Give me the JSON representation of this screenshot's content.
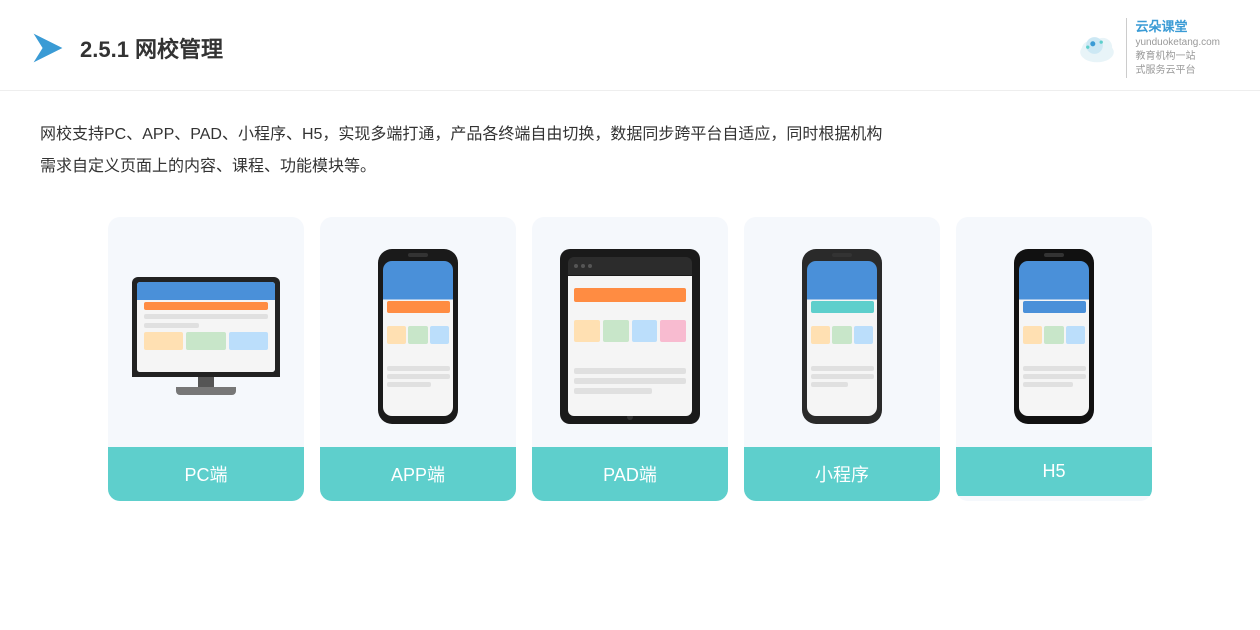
{
  "header": {
    "section_number": "2.5.1",
    "title_plain": "2.5.1 ",
    "title_bold": "网校管理",
    "brand_name": "云朵课堂",
    "brand_site": "yunduoketang.com",
    "brand_slogan_line1": "教育机构一站",
    "brand_slogan_line2": "式服务云平台"
  },
  "description": {
    "text_line1": "网校支持PC、APP、PAD、小程序、H5，实现多端打通，产品各终端自由切换，数据同步跨平台自适应，同时根据机构",
    "text_line2": "需求自定义页面上的内容、课程、功能模块等。"
  },
  "cards": [
    {
      "id": "pc",
      "label": "PC端"
    },
    {
      "id": "app",
      "label": "APP端"
    },
    {
      "id": "pad",
      "label": "PAD端"
    },
    {
      "id": "mini",
      "label": "小程序"
    },
    {
      "id": "h5",
      "label": "H5"
    }
  ],
  "colors": {
    "card_bg": "#f0f5fb",
    "card_label_bg": "#5ecfcc",
    "title_color": "#333333",
    "text_color": "#333333",
    "accent_blue": "#4a90d9",
    "accent_orange": "#ff8c42"
  }
}
